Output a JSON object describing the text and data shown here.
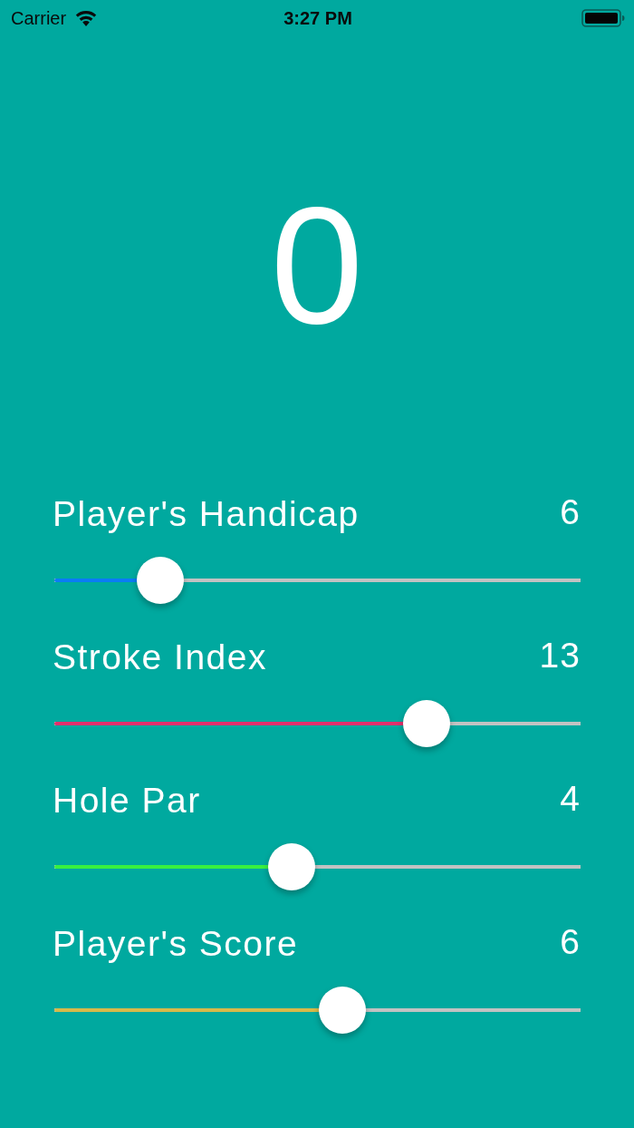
{
  "status_bar": {
    "carrier": "Carrier",
    "time": "3:27 PM"
  },
  "score_display": "0",
  "sliders": [
    {
      "label": "Player's Handicap",
      "value": "6",
      "level": 0.172,
      "color": "#0a7cf5"
    },
    {
      "label": "Stroke Index",
      "value": "13",
      "level": 0.728,
      "color": "#e2306c"
    },
    {
      "label": "Hole Par",
      "value": "4",
      "level": 0.446,
      "color": "#38f03f"
    },
    {
      "label": "Player's Score",
      "value": "6",
      "level": 0.552,
      "color": "#d6ba4a"
    }
  ]
}
